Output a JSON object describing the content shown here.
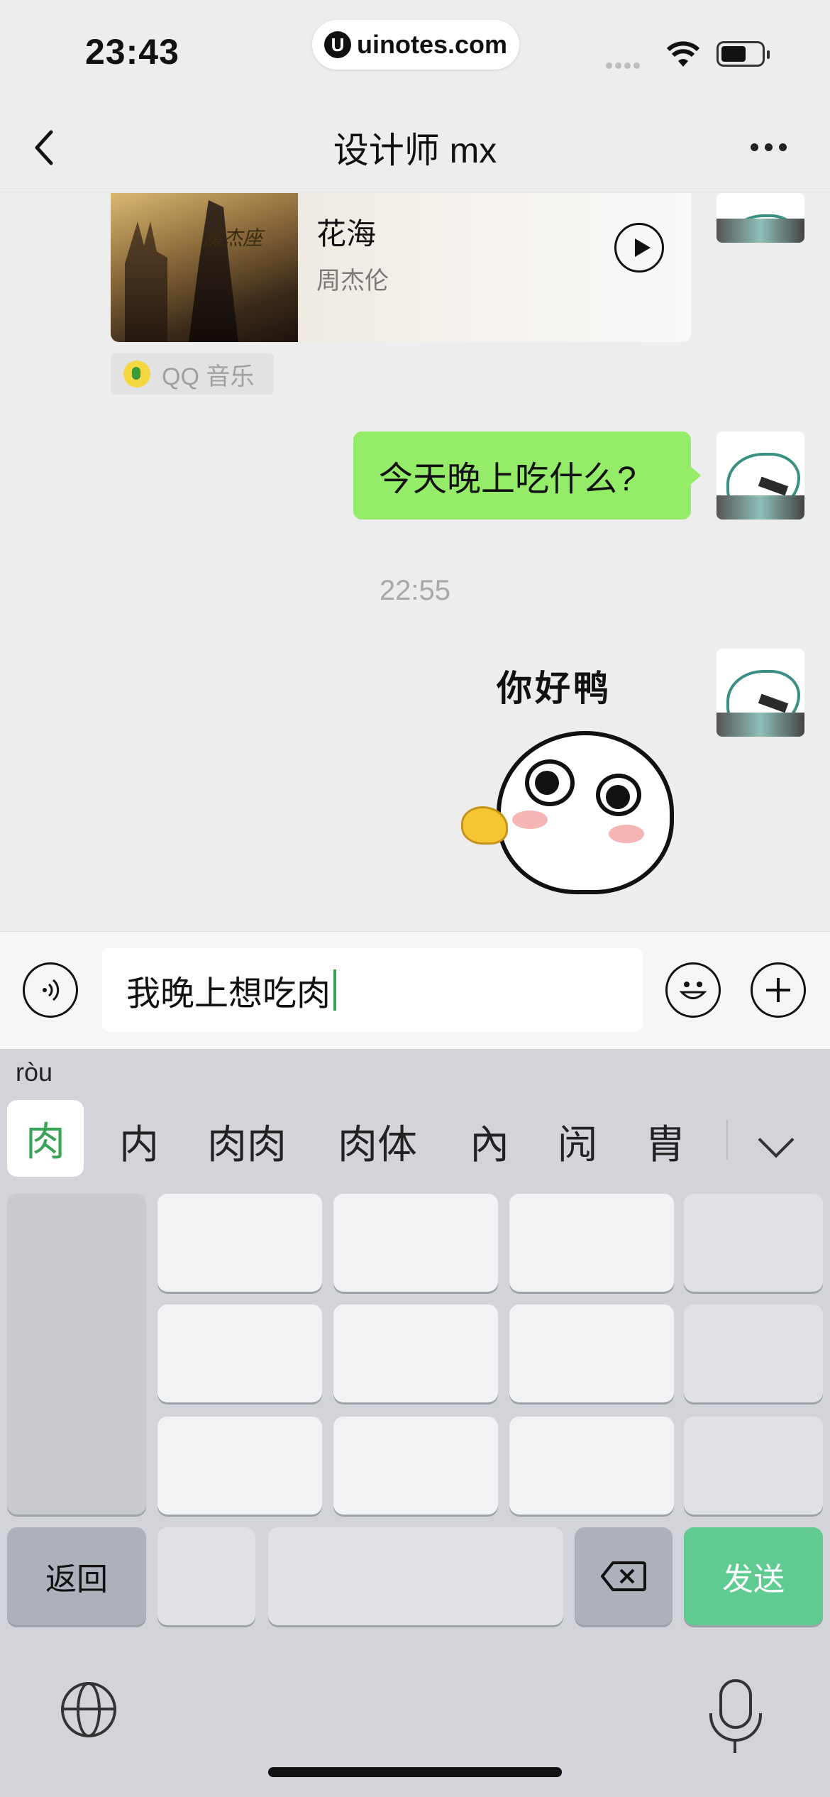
{
  "status_bar": {
    "time": "23:43",
    "url": "uinotes.com",
    "url_icon": "U"
  },
  "nav": {
    "title": "设计师 mx"
  },
  "music_card": {
    "song": "花海",
    "artist": "周杰伦",
    "cover_text": "魔杰座",
    "source": "QQ 音乐"
  },
  "messages": {
    "bubble_text": "今天晚上吃什么?",
    "timestamp": "22:55",
    "sticker_text": "你好鸭"
  },
  "input": {
    "value": "我晚上想吃肉"
  },
  "keyboard": {
    "pinyin": "ròu",
    "candidates": [
      "肉",
      "内",
      "肉肉",
      "肉体",
      "內",
      "闶",
      "胄"
    ],
    "return_label": "返回",
    "send_label": "发送"
  },
  "colors": {
    "bubble": "#95ec69",
    "send": "#5fcb91",
    "accent": "#3aa356"
  }
}
